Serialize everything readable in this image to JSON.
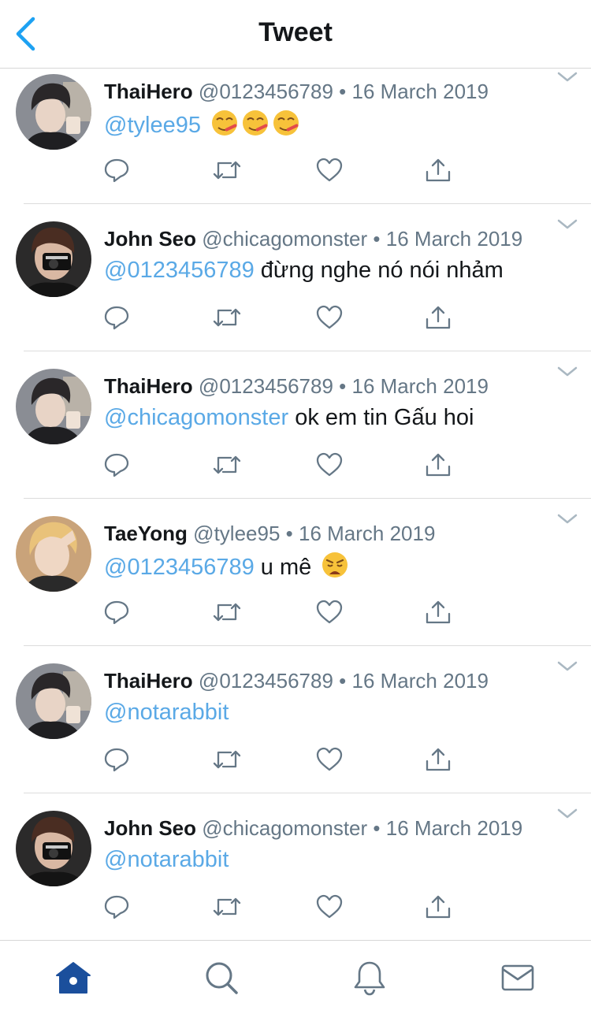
{
  "header": {
    "title": "Tweet",
    "back_icon": "chevron-left-icon"
  },
  "colors": {
    "accent": "#1da1f2",
    "mention": "#5aa9e6",
    "muted": "#657786",
    "text": "#14171a",
    "home_active": "#1b4f9c"
  },
  "tweets": [
    {
      "name": "ThaiHero",
      "handle": "@0123456789",
      "dot": "•",
      "date": "16 March 2019",
      "mention": "@tylee95",
      "text": "",
      "emoji": "🤒🤒🤒",
      "avatar": "avatar-thaihero"
    },
    {
      "name": "John Seo",
      "handle": "@chicagomonster",
      "dot": "•",
      "date": "16 March 2019",
      "mention": "@0123456789",
      "text": " đừng nghe nó nói nhảm",
      "emoji": "",
      "avatar": "avatar-johnseo"
    },
    {
      "name": "ThaiHero",
      "handle": "@0123456789",
      "dot": "•",
      "date": "16 March 2019",
      "mention": "@chicagomonster",
      "text": " ok em tin Gấu hoi",
      "emoji": "",
      "avatar": "avatar-thaihero"
    },
    {
      "name": "TaeYong",
      "handle": "@tylee95",
      "dot": "•",
      "date": "16 March 2019",
      "mention": "@0123456789",
      "text": " u mê",
      "emoji": "😩",
      "avatar": "avatar-taeyong"
    },
    {
      "name": "ThaiHero",
      "handle": "@0123456789",
      "dot": "•",
      "date": "16 March 2019",
      "mention": "@notarabbit",
      "text": "",
      "emoji": "",
      "avatar": "avatar-thaihero"
    },
    {
      "name": "John Seo",
      "handle": "@chicagomonster",
      "dot": "•",
      "date": "16 March 2019",
      "mention": "@notarabbit",
      "text": "",
      "emoji": "",
      "avatar": "avatar-johnseo"
    }
  ],
  "tweet_actions": [
    "reply-icon",
    "retweet-icon",
    "like-icon",
    "share-icon"
  ],
  "tabbar": {
    "items": [
      {
        "icon": "home-icon",
        "active": true
      },
      {
        "icon": "search-icon",
        "active": false
      },
      {
        "icon": "notifications-bell-icon",
        "active": false
      },
      {
        "icon": "messages-envelope-icon",
        "active": false
      }
    ]
  }
}
